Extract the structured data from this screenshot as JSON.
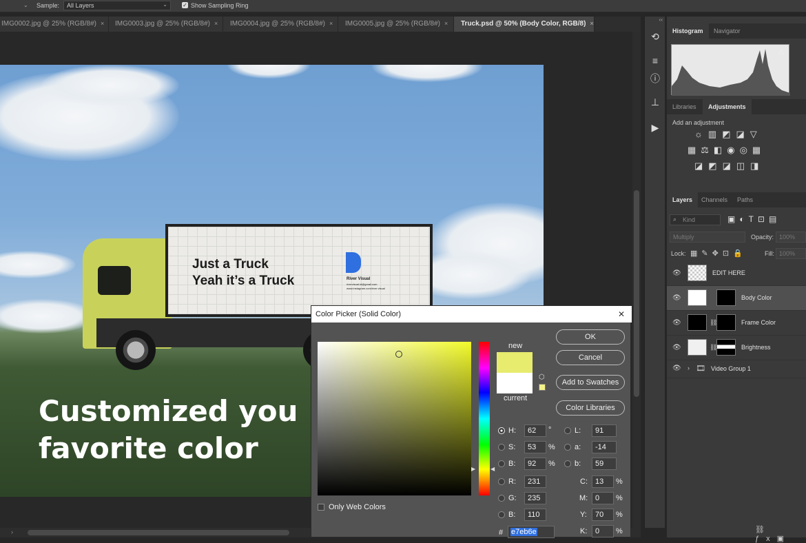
{
  "options_bar": {
    "sample_label": "Sample:",
    "sample_value": "All Layers",
    "show_sampling_ring": "Show Sampling Ring"
  },
  "tabs": [
    {
      "label": "IMG0002.jpg @ 25% (RGB/8#)",
      "close": "×"
    },
    {
      "label": "IMG0003.jpg @ 25% (RGB/8#)",
      "close": "×"
    },
    {
      "label": "IMG0004.jpg @ 25% (RGB/8#)",
      "close": "×"
    },
    {
      "label": "IMG0005.jpg @ 25% (RGB/8#)",
      "close": "×"
    },
    {
      "label": "Truck.psd @ 50% (Body Color, RGB/8)",
      "close": "×"
    }
  ],
  "canvas": {
    "truck_line1": "Just a Truck",
    "truck_line2": "Yeah it’s a Truck",
    "logo_name": "River Visual",
    "logo_email": "rivervisual.id@gmail.com",
    "logo_web": "www.instagram.com/river.visual",
    "headline_line1": "Customized you",
    "headline_line2": "favorite color"
  },
  "panels": {
    "top_tabs": [
      "Histogram",
      "Navigator"
    ],
    "mid_tabs": [
      "Libraries",
      "Adjustments"
    ],
    "add_adjustment": "Add an adjustment",
    "layer_tabs": [
      "Layers",
      "Channels",
      "Paths"
    ],
    "kind_placeholder": "Kind",
    "blend_mode": "Multiply",
    "opacity_label": "Opacity:",
    "opacity_value": "100%",
    "lock_label": "Lock:",
    "fill_label": "Fill:",
    "fill_value": "100%",
    "layers": [
      {
        "name": "EDIT HERE"
      },
      {
        "name": "Body Color"
      },
      {
        "name": "Frame Color"
      },
      {
        "name": "Brightness"
      },
      {
        "name": "Video Group 1"
      }
    ]
  },
  "color_picker": {
    "title": "Color Picker (Solid Color)",
    "close": "✕",
    "ok": "OK",
    "cancel": "Cancel",
    "add_to_swatches": "Add to Swatches",
    "color_libraries": "Color Libraries",
    "new_label": "new",
    "current_label": "current",
    "new_color": "#e7eb6e",
    "current_color": "#ffffff",
    "only_web_colors": "Only Web Colors",
    "fields": {
      "H": "62",
      "S": "53",
      "B": "92",
      "R": "231",
      "G": "235",
      "Bv": "110",
      "L": "91",
      "a": "-14",
      "b": "59",
      "C": "13",
      "M": "0",
      "Y": "70",
      "K": "0"
    },
    "units": {
      "deg": "°",
      "pct": "%"
    },
    "hex_label": "#",
    "hex": "e7eb6e"
  }
}
